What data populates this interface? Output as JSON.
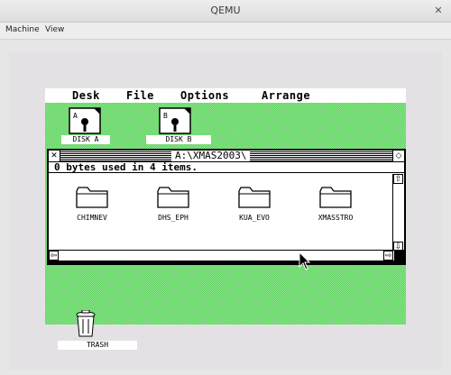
{
  "window": {
    "title": "QEMU"
  },
  "menu": {
    "machine": "Machine",
    "view": "View"
  },
  "gem": {
    "menus": [
      "Desk",
      "File",
      "Options",
      "Arrange"
    ],
    "drives": [
      {
        "label": "DISK A",
        "letter": "A"
      },
      {
        "label": "DISK B",
        "letter": "B"
      }
    ],
    "window": {
      "path": "A:\\XMAS2003\\",
      "info": "0 bytes used in 4 items.",
      "folders": [
        "CHIMNEV",
        "DHS_EPH",
        "KUA_EVO",
        "XMASSTRO"
      ]
    },
    "trash_label": "TRASH"
  },
  "colors": {
    "desktop": "#5ad45a",
    "screen_bg": "#e4e1e4"
  }
}
